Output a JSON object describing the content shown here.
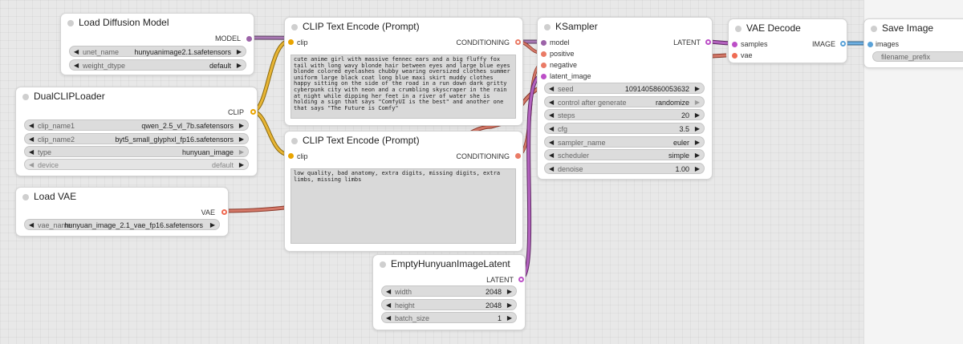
{
  "colors": {
    "model": "#9c63a8",
    "clip": "#e9a400",
    "conditioning": "#ea7b66",
    "latent": "#bc4fc7",
    "vae": "#ef6b53",
    "image": "#5aa2d8"
  },
  "nodes": {
    "load_diffusion_model": {
      "title": "Load Diffusion Model",
      "output_model": "MODEL",
      "unet_name": {
        "label": "unet_name",
        "value": "hunyuanimage2.1.safetensors"
      },
      "weight_dtype": {
        "label": "weight_dtype",
        "value": "default"
      }
    },
    "dual_clip_loader": {
      "title": "DualCLIPLoader",
      "output_clip": "CLIP",
      "clip_name1": {
        "label": "clip_name1",
        "value": "qwen_2.5_vl_7b.safetensors"
      },
      "clip_name2": {
        "label": "clip_name2",
        "value": "byt5_small_glyphxl_fp16.safetensors"
      },
      "type": {
        "label": "type",
        "value": "hunyuan_image"
      },
      "device": {
        "label": "device",
        "value": "default"
      }
    },
    "load_vae": {
      "title": "Load VAE",
      "output_vae": "VAE",
      "vae_name": {
        "label": "vae_name",
        "value": "hunyuan_image_2.1_vae_fp16.safetensors"
      }
    },
    "clip_text_encode_positive": {
      "title": "CLIP Text Encode (Prompt)",
      "input_clip": "clip",
      "output_conditioning": "CONDITIONING",
      "text": "cute anime girl with massive fennec ears and a big fluffy fox tail with long wavy blonde hair between eyes and large blue eyes blonde colored eyelashes chubby wearing oversized clothes summer uniform large black coat long blue maxi skirt muddy clothes happy sitting on the side of the road in a run down dark gritty cyberpunk city with neon and a crumbling skyscraper in the rain at night while dipping her feet in a river of water she is holding a sign that says \"ComfyUI is the best\" and another one that says \"The Future is Comfy\""
    },
    "clip_text_encode_negative": {
      "title": "CLIP Text Encode (Prompt)",
      "input_clip": "clip",
      "output_conditioning": "CONDITIONING",
      "text": "low quality, bad anatomy, extra digits, missing digits, extra limbs, missing limbs"
    },
    "empty_latent": {
      "title": "EmptyHunyuanImageLatent",
      "output_latent": "LATENT",
      "width": {
        "label": "width",
        "value": "2048"
      },
      "height": {
        "label": "height",
        "value": "2048"
      },
      "batch_size": {
        "label": "batch_size",
        "value": "1"
      }
    },
    "ksampler": {
      "title": "KSampler",
      "input_model": "model",
      "input_positive": "positive",
      "input_negative": "negative",
      "input_latent_image": "latent_image",
      "output_latent": "LATENT",
      "seed": {
        "label": "seed",
        "value": "1091405860053632"
      },
      "control_after_generate": {
        "label": "control after generate",
        "value": "randomize"
      },
      "steps": {
        "label": "steps",
        "value": "20"
      },
      "cfg": {
        "label": "cfg",
        "value": "3.5"
      },
      "sampler_name": {
        "label": "sampler_name",
        "value": "euler"
      },
      "scheduler": {
        "label": "scheduler",
        "value": "simple"
      },
      "denoise": {
        "label": "denoise",
        "value": "1.00"
      }
    },
    "vae_decode": {
      "title": "VAE Decode",
      "input_samples": "samples",
      "input_vae": "vae",
      "output_image": "IMAGE"
    },
    "save_image": {
      "title": "Save Image",
      "input_images": "images",
      "filename_prefix_placeholder": "filename_prefix"
    }
  }
}
